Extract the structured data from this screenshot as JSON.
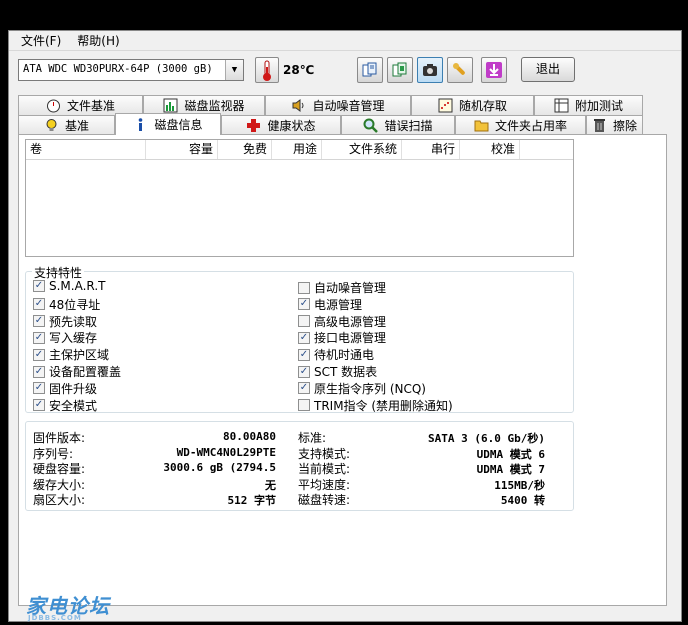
{
  "menu": {
    "file": "文件(F)",
    "help": "帮助(H)"
  },
  "toolbar": {
    "drive": "ATA   WDC WD30PURX-64P (3000 gB)",
    "temperature": "28℃",
    "exit_label": "退出",
    "buttons": [
      "copy-text-icon",
      "copy-info-icon",
      "screenshot-icon",
      "options-icon",
      "download-icon"
    ]
  },
  "tabs_row1": [
    "文件基准",
    "磁盘监视器",
    "自动噪音管理",
    "随机存取",
    "附加测试"
  ],
  "tabs_row2": [
    "基准",
    "磁盘信息",
    "健康状态",
    "错误扫描",
    "文件夹占用率",
    "擦除"
  ],
  "volume_table": {
    "columns": [
      "卷",
      "容量",
      "免费",
      "用途",
      "文件系统",
      "串行",
      "校准"
    ]
  },
  "features": {
    "title": "支持特性",
    "left": [
      {
        "label": "S.M.A.R.T",
        "checked": true
      },
      {
        "label": "48位寻址",
        "checked": true
      },
      {
        "label": "预先读取",
        "checked": true
      },
      {
        "label": "写入缓存",
        "checked": true
      },
      {
        "label": "主保护区域",
        "checked": true
      },
      {
        "label": "设备配置覆盖",
        "checked": true
      },
      {
        "label": "固件升级",
        "checked": true
      },
      {
        "label": "安全模式",
        "checked": true
      }
    ],
    "right": [
      {
        "label": "自动噪音管理",
        "checked": false
      },
      {
        "label": "电源管理",
        "checked": true
      },
      {
        "label": "高级电源管理",
        "checked": false
      },
      {
        "label": "接口电源管理",
        "checked": true
      },
      {
        "label": "待机时通电",
        "checked": true
      },
      {
        "label": "SCT 数据表",
        "checked": true
      },
      {
        "label": "原生指令序列 (NCQ)",
        "checked": true
      },
      {
        "label": "TRIM指令 (禁用删除通知)",
        "checked": false
      }
    ]
  },
  "info": {
    "left": [
      {
        "label": "固件版本:",
        "value": "80.00A80"
      },
      {
        "label": "序列号:",
        "value": "WD-WMC4N0L29PTE"
      },
      {
        "label": "硬盘容量:",
        "value": "3000.6 gB (2794.5"
      },
      {
        "label": "缓存大小:",
        "value": "无"
      },
      {
        "label": "扇区大小:",
        "value": "512 字节"
      }
    ],
    "right": [
      {
        "label": "标准:",
        "value": "SATA 3 (6.0 Gb/秒)"
      },
      {
        "label": "支持模式:",
        "value": "UDMA 模式 6"
      },
      {
        "label": "当前模式:",
        "value": "UDMA 模式 7"
      },
      {
        "label": "平均速度:",
        "value": "115MB/秒"
      },
      {
        "label": "磁盘转速:",
        "value": "5400 转"
      }
    ]
  },
  "watermark": {
    "text": "家电论坛",
    "sub": "JDBBS.COM"
  }
}
